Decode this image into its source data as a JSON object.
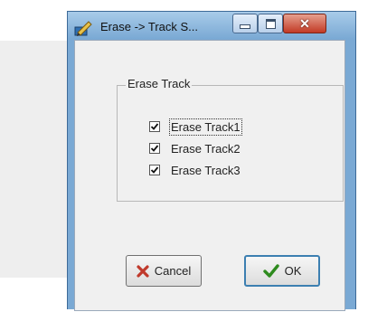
{
  "window": {
    "title": "Erase -> Track S..."
  },
  "group": {
    "title": "Erase Track",
    "options": [
      {
        "label": "Erase Track1",
        "checked": true
      },
      {
        "label": "Erase Track2",
        "checked": true
      },
      {
        "label": "Erase Track3",
        "checked": true
      }
    ]
  },
  "buttons": {
    "cancel_label": "Cancel",
    "ok_label": "OK"
  },
  "icons": {
    "app": "pencil-icon",
    "cancel": "red-x-icon",
    "ok": "green-check-icon"
  },
  "colors": {
    "titlebar": "#7aa9d4",
    "close_button": "#c23a25",
    "cancel_icon": "#c0392b",
    "ok_icon": "#2e8b1e"
  }
}
